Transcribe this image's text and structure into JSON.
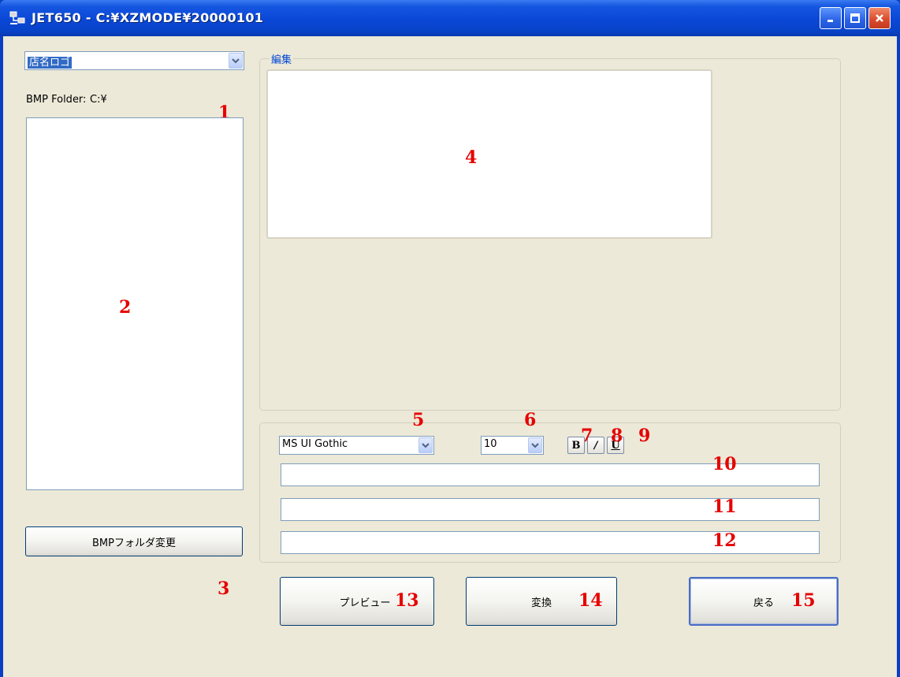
{
  "window": {
    "title": "JET650 - C:¥XZMODE¥20000101"
  },
  "left": {
    "combo_value": "店名ロゴ",
    "bmp_folder_label": "BMP Folder:",
    "bmp_folder_value": "C:¥",
    "change_folder_button": "BMPフォルダ変更"
  },
  "edit_group": {
    "label": "編集"
  },
  "format": {
    "font_value": "MS UI Gothic",
    "size_value": "10",
    "bold_label": "B",
    "italic_label": "/",
    "underline_label": "U"
  },
  "buttons": {
    "preview": "プレビュー",
    "convert": "変換",
    "back": "戻る"
  },
  "markers": [
    "1",
    "2",
    "3",
    "4",
    "5",
    "6",
    "7",
    "8",
    "9",
    "10",
    "11",
    "12",
    "13",
    "14",
    "15"
  ],
  "colors": {
    "marker": "#e60000",
    "titlebar": "#0a47d6",
    "client_bg": "#ece9d8"
  }
}
